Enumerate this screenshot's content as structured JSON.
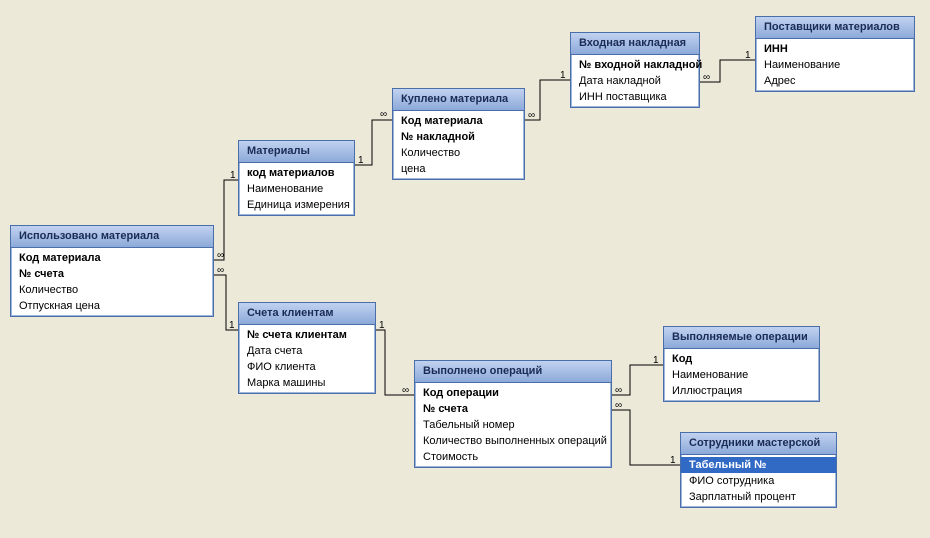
{
  "tables": {
    "used_material": {
      "title": "Использовано материала",
      "fields": [
        "Код материала",
        "№ счета",
        "Количество",
        "Отпускная цена"
      ]
    },
    "materials": {
      "title": "Материалы",
      "fields": [
        "код материалов",
        "Наименование",
        "Единица измерения"
      ]
    },
    "bought_material": {
      "title": "Куплено материала",
      "fields": [
        "Код материала",
        "№ накладной",
        "Количество",
        "цена"
      ]
    },
    "incoming_invoice": {
      "title": "Входная накладная",
      "fields": [
        "№ входной накладной",
        "Дата накладной",
        "ИНН поставщика"
      ]
    },
    "suppliers": {
      "title": "Поставщики материалов",
      "fields": [
        "ИНН",
        "Наименование",
        "Адрес"
      ]
    },
    "client_accounts": {
      "title": "Счета клиентам",
      "fields": [
        "№ счета клиентам",
        "Дата счета",
        "ФИО клиента",
        "Марка машины"
      ]
    },
    "performed_operations": {
      "title": "Выполнено операций",
      "fields": [
        "Код операции",
        "№ счета",
        "Табельный номер",
        "Количество выполненных операций",
        "Стоимость"
      ]
    },
    "operations_list": {
      "title": "Выполняемые операции",
      "fields": [
        "Код",
        "Наименование",
        "Иллюстрация"
      ]
    },
    "workshop_staff": {
      "title": "Сотрудники мастерской",
      "fields": [
        "Табельный №",
        "ФИО сотрудника",
        "Зарплатный процент"
      ]
    }
  },
  "relationships": [
    {
      "from": "used_material",
      "to": "materials",
      "from_card": "∞",
      "to_card": "1"
    },
    {
      "from": "materials",
      "to": "bought_material",
      "from_card": "1",
      "to_card": "∞"
    },
    {
      "from": "bought_material",
      "to": "incoming_invoice",
      "from_card": "∞",
      "to_card": "1"
    },
    {
      "from": "incoming_invoice",
      "to": "suppliers",
      "from_card": "∞",
      "to_card": "1"
    },
    {
      "from": "used_material",
      "to": "client_accounts",
      "from_card": "∞",
      "to_card": "1"
    },
    {
      "from": "client_accounts",
      "to": "performed_operations",
      "from_card": "1",
      "to_card": "∞"
    },
    {
      "from": "performed_operations",
      "to": "operations_list",
      "from_card": "∞",
      "to_card": "1"
    },
    {
      "from": "performed_operations",
      "to": "workshop_staff",
      "from_card": "∞",
      "to_card": "1"
    }
  ],
  "selected_field": "workshop_staff.Табельный №",
  "colors": {
    "background": "#ece9d8",
    "header_gradient_top": "#c1d2f0",
    "header_gradient_bottom": "#8ca9d9",
    "border": "#4a6ea9",
    "selection": "#316ac5"
  }
}
